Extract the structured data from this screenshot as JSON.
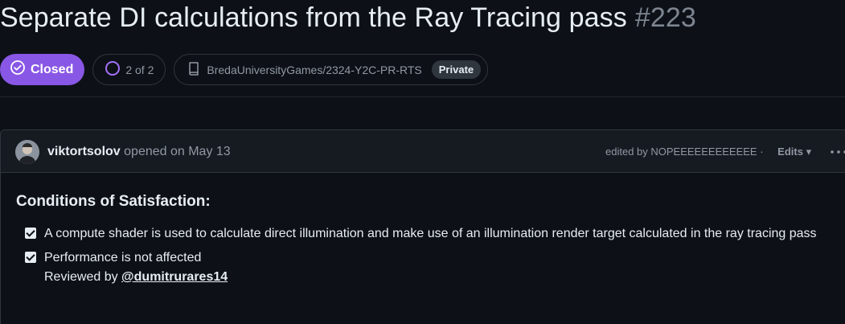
{
  "issue": {
    "title": "Separate DI calculations from the Ray Tracing pass",
    "number": "#223",
    "state_label": "Closed",
    "state_color": "#8957e5",
    "subissues": "2 of 2",
    "repo": "BredaUniversityGames/2324-Y2C-PR-RTS",
    "visibility": "Private"
  },
  "comment": {
    "author": "viktortsolov",
    "opened_text": "opened on May 13",
    "edited_text": "edited by NOPEEEEEEEEEEEE ·",
    "edits_label": "Edits ▾",
    "heading": "Conditions of Satisfaction:",
    "tasks": [
      {
        "text": "A compute shader is used to calculate direct illumination and make use of an illumination render target calculated in the ray tracing pass",
        "checked": true
      },
      {
        "text": "Performance is not affected",
        "checked": true
      }
    ],
    "reviewed_prefix": "Reviewed by ",
    "reviewer": "@dumitrurares14"
  },
  "icons": {
    "state": "check-circle-icon",
    "subissues": "progress-circle-icon",
    "repo": "repo-icon",
    "more": "kebab-horizontal-icon"
  }
}
